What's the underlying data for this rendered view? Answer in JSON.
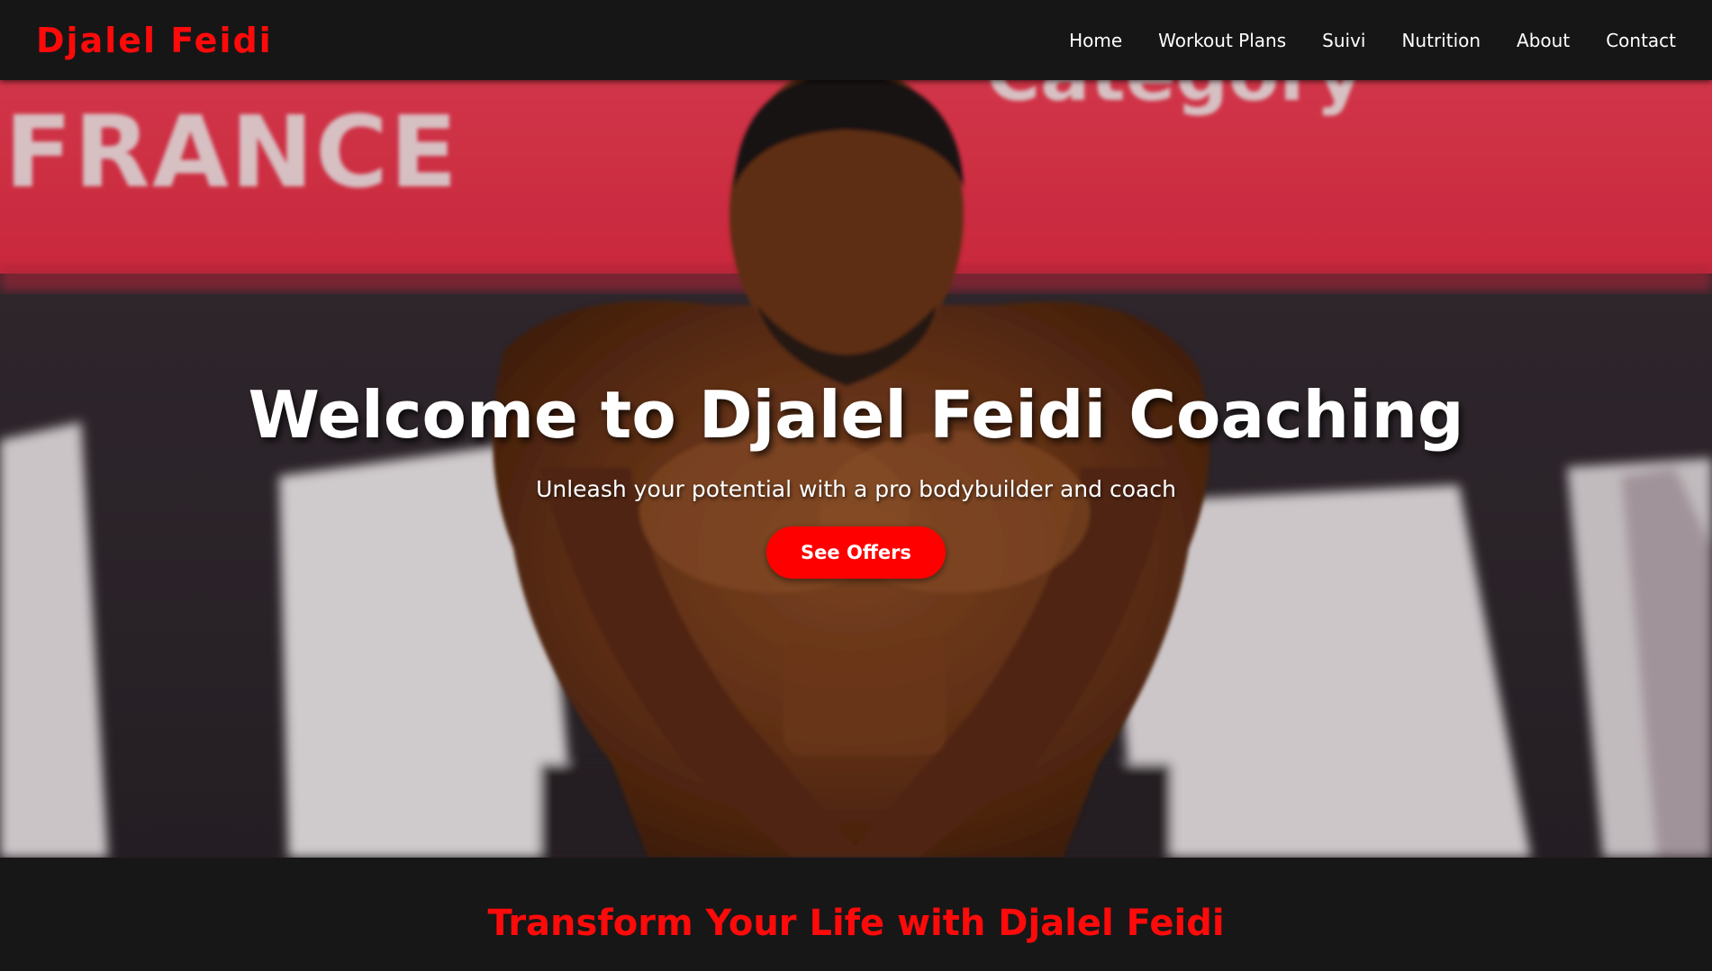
{
  "brand": {
    "name": "Djalel Feidi",
    "color": "#ff0a0a"
  },
  "nav": {
    "items": [
      {
        "label": "Home"
      },
      {
        "label": "Workout Plans"
      },
      {
        "label": "Suivi"
      },
      {
        "label": "Nutrition"
      },
      {
        "label": "About"
      },
      {
        "label": "Contact"
      }
    ]
  },
  "hero": {
    "title": "Welcome to Djalel Feidi Coaching",
    "subtitle": "Unleash your potential with a pro bodybuilder and coach",
    "cta_label": "See Offers",
    "banner_text": "FRANCE",
    "banner_text_secondary": "Category",
    "cta_color": "#ff0000"
  },
  "section": {
    "title": "Transform Your Life with Djalel Feidi"
  },
  "colors": {
    "navbar_bg": "#161616",
    "accent_red": "#ff0a0a",
    "banner_red": "#e8344a"
  }
}
